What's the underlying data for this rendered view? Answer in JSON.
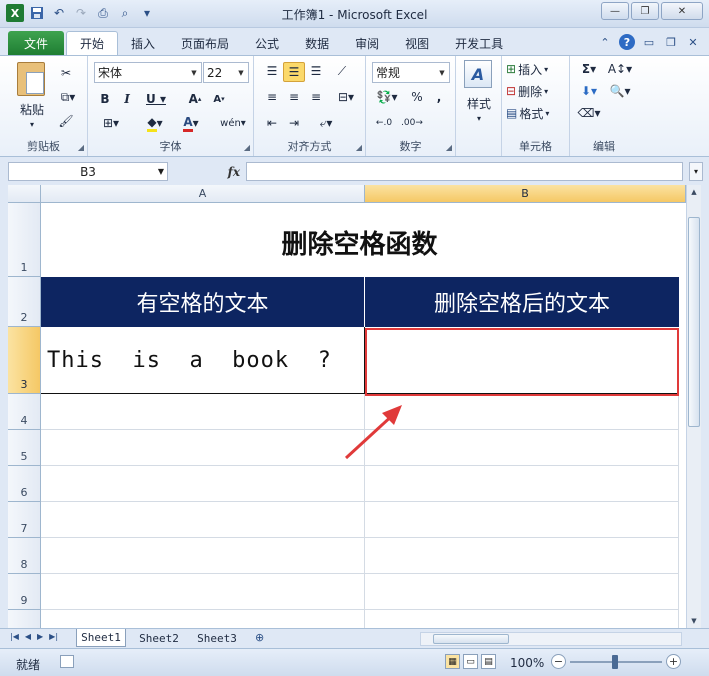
{
  "window": {
    "title": "工作簿1 - Microsoft Excel"
  },
  "ribbon": {
    "file_tab": "文件",
    "tabs": [
      "开始",
      "插入",
      "页面布局",
      "公式",
      "数据",
      "审阅",
      "视图",
      "开发工具"
    ],
    "active_tab": "开始",
    "groups": {
      "clipboard": {
        "label": "剪贴板",
        "paste": "粘贴"
      },
      "font": {
        "label": "字体",
        "font_name": "宋体",
        "font_size": "22"
      },
      "alignment": {
        "label": "对齐方式"
      },
      "number": {
        "label": "数字",
        "format": "常规"
      },
      "styles": {
        "label": "样式"
      },
      "cells": {
        "label": "单元格",
        "insert": "插入",
        "delete": "删除",
        "format": "格式"
      },
      "editing": {
        "label": "编辑"
      }
    }
  },
  "formula_bar": {
    "name_box": "B3",
    "fx": "fx",
    "formula": ""
  },
  "sheet": {
    "columns": [
      "A",
      "B"
    ],
    "selected_column": "B",
    "rows": [
      "1",
      "2",
      "3",
      "4",
      "5",
      "6",
      "7",
      "8",
      "9"
    ],
    "selected_row": "3",
    "title": "删除空格函数",
    "header_a": "有空格的文本",
    "header_b": "删除空格后的文本",
    "cell_a3": "This  is  a  book  ?",
    "cell_b3": ""
  },
  "sheet_tabs": [
    "Sheet1",
    "Sheet2",
    "Sheet3"
  ],
  "active_sheet": "Sheet1",
  "status": {
    "text": "就绪",
    "zoom": "100%"
  },
  "colors": {
    "header_fill": "#0d2561",
    "highlight_box": "#e03a3a",
    "file_tab": "#1f7e33"
  }
}
